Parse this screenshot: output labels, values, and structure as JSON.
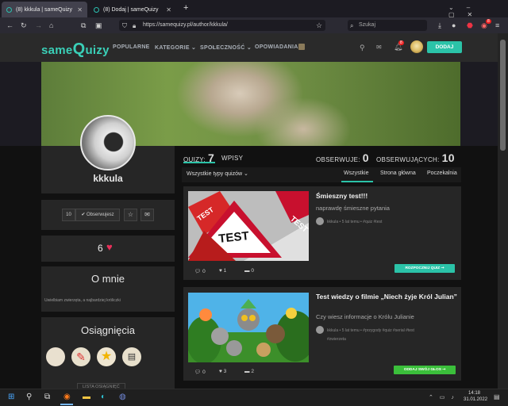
{
  "browser": {
    "tabs": [
      {
        "label": "(8) kkkula | sameQuizy",
        "active": true
      },
      {
        "label": "(8) Dodaj | sameQuizy",
        "active": false
      }
    ],
    "new_tab": "+",
    "url": "https://samequizy.pl/author/kkkula/",
    "search_placeholder": "Szukaj",
    "notif_count": "8"
  },
  "site": {
    "logo_pre": "same",
    "logo_q": "Q",
    "logo_post": "uizy",
    "nav": [
      "POPULARNE",
      "KATEGORIE ⌄",
      "SPOŁECZNOŚĆ ⌄",
      "OPOWIADANIA"
    ],
    "bell_count": "8",
    "add_label": "DODAJ"
  },
  "profile": {
    "username": "kkkula",
    "follow_count": "10",
    "follow_label": "✔ Obserwujesz",
    "hearts": "6",
    "about_title": "O mnie",
    "about_text": "Uwielbiam zwierzęta, a najbardziej króliczki",
    "achievements_title": "Osiągnięcia",
    "achievements_link": "LISTA OSIĄGNIĘĆ"
  },
  "stats": {
    "quizy_label": "QUIZY:",
    "quizy_value": "7",
    "wpisy_label": "WPISY",
    "obs_label": "OBSERWUJE:",
    "obs_value": "0",
    "obsj_label": "OBSERWUJĄCYCH:",
    "obsj_value": "10"
  },
  "filter": {
    "types": "Wszystkie typy quizów ⌄",
    "tabs": [
      "Wszystkie",
      "Strona główna",
      "Poczekalnia"
    ]
  },
  "quizzes": [
    {
      "title": "Śmieszny test!!!",
      "desc": "naprawdę śmieszne pytania",
      "meta": "kkkula • 5 lat temu • #quiz #test",
      "meta2": "",
      "comments": "0",
      "likes": "1",
      "views": "0",
      "button": "ROZPOCZNIJ QUIZ ➞",
      "button_color": "#2bc3a8"
    },
    {
      "title": "Test wiedzy o filmie „Niech żyje Król Julian”",
      "desc": "Czy wiesz informacje o Królu Julianie",
      "meta": "kkkula • 5 lat temu • #przygody #quiz #serial #test",
      "meta2": "#zwierzeta",
      "comments": "0",
      "likes": "3",
      "views": "2",
      "button": "ODDAJ SWÓJ GŁOS ➞",
      "button_color": "#3bbf3b"
    }
  ],
  "taskbar": {
    "time": "14:18",
    "date": "31.01.2022"
  }
}
